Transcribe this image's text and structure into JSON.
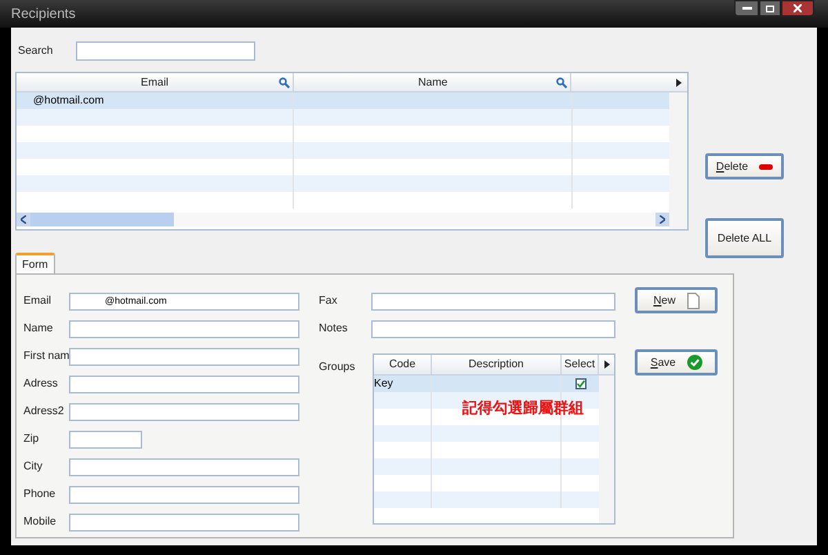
{
  "window": {
    "title": "Recipients"
  },
  "search": {
    "label": "Search"
  },
  "recipients_table": {
    "columns": [
      "Email",
      "Name"
    ],
    "rows": [
      {
        "email": "@hotmail.com",
        "selected": true
      }
    ]
  },
  "buttons": [
    {
      "label": "Delete",
      "kind": "delete"
    },
    {
      "label": "Delete ALL",
      "kind": "delete_all"
    }
  ],
  "tabs": [
    {
      "label": "Form",
      "selected": true
    }
  ],
  "form": {
    "fields": [
      {
        "label": "Email",
        "value": "@hotmail.com"
      },
      {
        "label": "Name"
      },
      {
        "label": "First nam"
      },
      {
        "label": "Adress"
      },
      {
        "label": "Adress2"
      },
      {
        "label": "Zip",
        "kind": "short"
      },
      {
        "label": "City"
      },
      {
        "label": "Phone"
      },
      {
        "label": "Mobile"
      }
    ],
    "side_fields": [
      {
        "label": "Fax"
      },
      {
        "label": "Notes"
      }
    ],
    "groups": {
      "label": "Groups",
      "columns": [
        "Code",
        "Description",
        "Select"
      ],
      "rows": [
        {
          "code": "Key",
          "checked": true,
          "selected": true
        }
      ],
      "note": "記得勾選歸屬群組"
    }
  },
  "actions": [
    {
      "label": "New",
      "kind": "new"
    },
    {
      "label": "Save",
      "kind": "save"
    }
  ]
}
